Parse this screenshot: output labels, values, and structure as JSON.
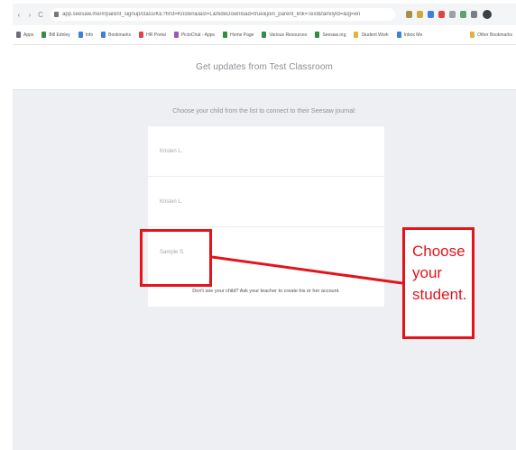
{
  "browser": {
    "url": "app.seesaw.me/#/parent_signup/class/KE?first=Kristen&last=L&hideDownload=true&join_parent_link=Text&familyId=&lg=en",
    "nav": [
      "‹",
      "›",
      "C"
    ],
    "extensions": [
      {
        "name": "ext-1",
        "color": "#a98c4a"
      },
      {
        "name": "ext-2",
        "color": "#d0a73c"
      },
      {
        "name": "ext-3",
        "color": "#3f7fe0"
      },
      {
        "name": "ext-4",
        "color": "#e04545"
      },
      {
        "name": "ext-5",
        "color": "#9aa0a6"
      },
      {
        "name": "ext-6",
        "color": "#5fa06b"
      },
      {
        "name": "ext-7",
        "color": "#7a7f86"
      }
    ],
    "bookmarks": [
      {
        "label": "Apps",
        "color": "#6a6e75"
      },
      {
        "label": "Bill Ednley",
        "color": "#3a8a4a"
      },
      {
        "label": "Info",
        "color": "#3f7fe0"
      },
      {
        "label": "Bookmarks",
        "color": "#3f7fe0"
      },
      {
        "label": "HR Portal",
        "color": "#e04545"
      },
      {
        "label": "PictoChat - Apps",
        "color": "#9b59b6"
      },
      {
        "label": "Home Page",
        "color": "#2f8f43"
      },
      {
        "label": "Various Resources",
        "color": "#2f8f43"
      },
      {
        "label": "Seesaw.org",
        "color": "#2f8f43"
      },
      {
        "label": "Student Work",
        "color": "#e0b43c"
      },
      {
        "label": "Inbox Me",
        "color": "#3f7fe0"
      }
    ],
    "bookmarks_right": {
      "label": "Other Bookmarks",
      "color": "#e0b43c"
    }
  },
  "header": {
    "title": "Get updates from Test Classroom"
  },
  "main": {
    "prompt": "Choose your child from the list to connect to their Seesaw journal:",
    "students": [
      "Kristen L.",
      "Kristen L.",
      "Sample S."
    ],
    "help_text": "Don't see your child? Ask your teacher to create his or her account."
  },
  "annotation": {
    "callout_lines": [
      "Choose",
      "your",
      "student."
    ],
    "color": "#e3141b"
  }
}
